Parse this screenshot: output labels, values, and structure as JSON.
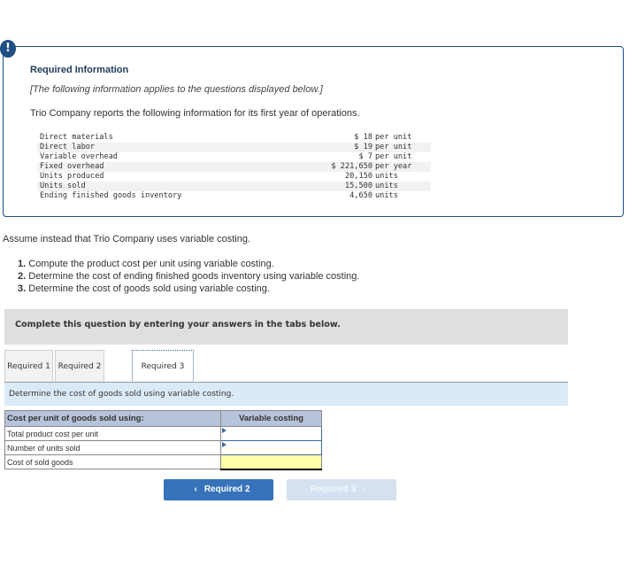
{
  "alert": {
    "icon": "exclamation-icon",
    "symbol": "!"
  },
  "required_info": {
    "title": "Required Information",
    "note": "[The following information applies to the questions displayed below.]",
    "intro": "Trio Company reports the following information for its first year of operations.",
    "rows": [
      {
        "label": "Direct materials",
        "value": "$ 18",
        "unit": "per unit"
      },
      {
        "label": "Direct labor",
        "value": "$ 19",
        "unit": "per unit"
      },
      {
        "label": "Variable overhead",
        "value": "$ 7",
        "unit": "per unit"
      },
      {
        "label": "Fixed overhead",
        "value": "$ 221,650",
        "unit": "per year"
      },
      {
        "label": "Units produced",
        "value": "20,150",
        "unit": "units"
      },
      {
        "label": "Units sold",
        "value": "15,500",
        "unit": "units"
      },
      {
        "label": "Ending finished goods inventory",
        "value": "4,650",
        "unit": "units"
      }
    ]
  },
  "question": {
    "assume": "Assume instead that Trio Company uses variable costing.",
    "tasks": [
      {
        "num": "1.",
        "text": "Compute the product cost per unit using variable costing."
      },
      {
        "num": "2.",
        "text": "Determine the cost of ending finished goods inventory using variable costing."
      },
      {
        "num": "3.",
        "text": "Determine the cost of goods sold using variable costing."
      }
    ]
  },
  "complete_bar": {
    "text": "Complete this question by entering your answers in the tabs below."
  },
  "tabs": [
    {
      "label": "Required 1",
      "active": false
    },
    {
      "label": "Required 2",
      "active": false
    },
    {
      "label": "Required 3",
      "active": true
    }
  ],
  "instruction": "Determine the cost of goods sold using variable costing.",
  "answer_table": {
    "header_label": "Cost per unit of goods sold using:",
    "header_col": "Variable costing",
    "rows": [
      {
        "label": "Total product cost per unit",
        "value": ""
      },
      {
        "label": "Number of units sold",
        "value": ""
      },
      {
        "label": "Cost of sold goods",
        "value": ""
      }
    ]
  },
  "nav": {
    "prev_label": "Required 2",
    "next_label": "Required 3",
    "prev_icon": "chevron-left-icon",
    "next_icon": "chevron-right-icon"
  },
  "colors": {
    "accent": "#1e4e82",
    "button_primary": "#3673ba",
    "button_disabled": "#d5e1f0",
    "instruction_bg": "#dbeaf7",
    "table_header_bg": "#b6c3da",
    "total_cell_bg": "#ffffaa"
  }
}
